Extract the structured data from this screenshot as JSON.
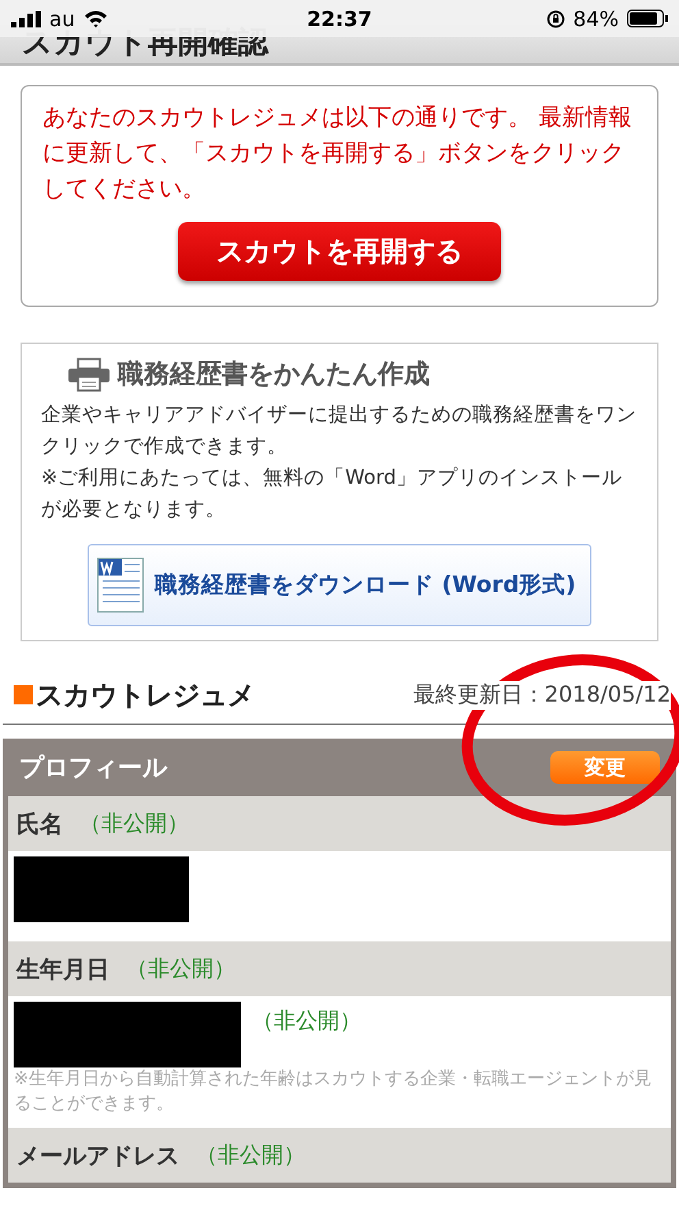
{
  "status_bar": {
    "carrier": "au",
    "time": "22:37",
    "battery": "84%"
  },
  "header": {
    "title": "スカウト再開確認"
  },
  "notice": {
    "message": "あなたのスカウトレジュメは以下の通りです。 最新情報に更新して、「スカウトを再開する」ボタンをクリックしてください。",
    "button": "スカウトを再開する"
  },
  "cv_card": {
    "title": "職務経歴書をかんたん作成",
    "description": "企業やキャリアアドバイザーに提出するための職務経歴書をワンクリックで作成できます。",
    "note": "※ご利用にあたっては、無料の「Word」アプリのインストールが必要となります。",
    "button": "職務経歴書をダウンロード (Word形式)"
  },
  "resume": {
    "title": "スカウトレジュメ",
    "updated": "最終更新日：2018/05/12"
  },
  "profile": {
    "title": "プロフィール",
    "edit_button": "変更",
    "fields": [
      {
        "label": "氏名",
        "visibility": "（非公開）",
        "value": {
          "kind": "redacted"
        }
      },
      {
        "label": "生年月日",
        "visibility": "（非公開）",
        "value": {
          "kind": "redacted"
        },
        "value_visibility": "（非公開）",
        "note": "※生年月日から自動計算された年齢はスカウトする企業・転職エージェントが見ることができます。"
      },
      {
        "label": "メールアドレス",
        "visibility": "（非公開）"
      }
    ]
  },
  "annotation": {
    "kind": "circle"
  }
}
